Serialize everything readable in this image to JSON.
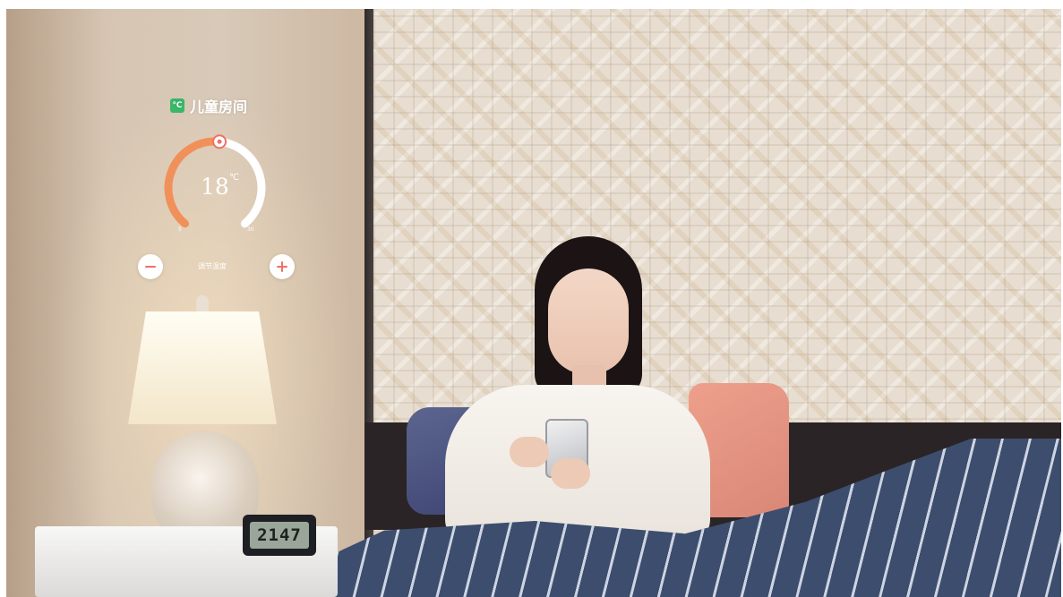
{
  "hud": {
    "room_name": "儿童房间",
    "room_icon": "thermometer-icon",
    "temperature": "18",
    "unit": "℃",
    "min": "5",
    "max": "30",
    "temperature_fraction": 0.52,
    "adjust_label": "调节温度",
    "minus_icon": "minus-icon",
    "plus_icon": "plus-icon"
  },
  "clock": {
    "time": "2147"
  },
  "colors": {
    "gauge_active": "#f0905a",
    "gauge_track": "#ffffff",
    "button_icon": "#f07064",
    "room_icon": "#39b86a"
  }
}
